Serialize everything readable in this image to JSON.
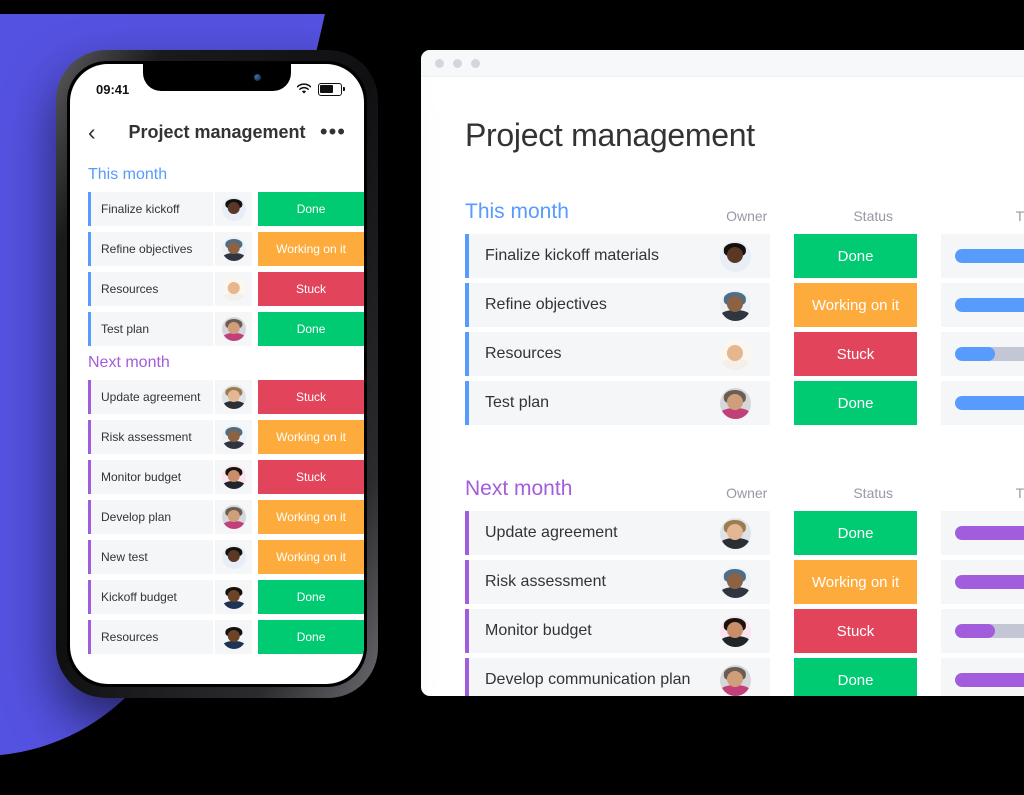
{
  "colors": {
    "blue": "#579bfc",
    "purple": "#a25ddc",
    "green": "#00ca72",
    "orange": "#fdab3d",
    "red": "#e2445c",
    "grey_track": "#c3c6d4",
    "bg_accent": "#5452e0"
  },
  "browser": {
    "window_dots": [
      "dot-1",
      "dot-2",
      "dot-3"
    ],
    "page_title": "Project management",
    "column_headers": {
      "owner": "Owner",
      "status": "Status",
      "timeline": "Timeline"
    },
    "sections": [
      {
        "title": "This month",
        "accent": "#579bfc",
        "rows": [
          {
            "name": "Finalize kickoff materials",
            "owner": "avatar-woman-glasses",
            "status": "Done",
            "status_color": "#00ca72",
            "timeline_pct": 72
          },
          {
            "name": "Refine objectives",
            "owner": "avatar-man-beard-cap",
            "status": "Working on it",
            "status_color": "#fdab3d",
            "timeline_pct": 72
          },
          {
            "name": "Resources",
            "owner": "avatar-woman-blonde",
            "status": "Stuck",
            "status_color": "#e2445c",
            "timeline_pct": 24
          },
          {
            "name": "Test plan",
            "owner": "avatar-man-beard",
            "status": "Done",
            "status_color": "#00ca72",
            "timeline_pct": 100
          }
        ]
      },
      {
        "title": "Next month",
        "accent": "#a25ddc",
        "rows": [
          {
            "name": "Update agreement",
            "owner": "avatar-man-blond",
            "status": "Done",
            "status_color": "#00ca72",
            "timeline_pct": 100
          },
          {
            "name": "Risk assessment",
            "owner": "avatar-man-beard-cap",
            "status": "Working on it",
            "status_color": "#fdab3d",
            "timeline_pct": 72
          },
          {
            "name": "Monitor budget",
            "owner": "avatar-woman-dark",
            "status": "Stuck",
            "status_color": "#e2445c",
            "timeline_pct": 24
          },
          {
            "name": "Develop communication plan",
            "owner": "avatar-man-beard",
            "status": "Done",
            "status_color": "#00ca72",
            "timeline_pct": 100
          }
        ]
      }
    ]
  },
  "phone": {
    "status_bar": {
      "time": "09:41",
      "wifi": "wifi-icon",
      "battery": "battery-icon"
    },
    "nav": {
      "back": "‹",
      "title": "Project management",
      "more": "•••"
    },
    "sections": [
      {
        "title": "This month",
        "accent": "#579bfc",
        "rows": [
          {
            "name": "Finalize kickoff",
            "owner": "avatar-woman-glasses",
            "status": "Done",
            "status_color": "#00ca72"
          },
          {
            "name": "Refine objectives",
            "owner": "avatar-man-beard-cap",
            "status": "Working on it",
            "status_color": "#fdab3d"
          },
          {
            "name": "Resources",
            "owner": "avatar-woman-blonde",
            "status": "Stuck",
            "status_color": "#e2445c"
          },
          {
            "name": "Test plan",
            "owner": "avatar-man-beard",
            "status": "Done",
            "status_color": "#00ca72"
          }
        ]
      },
      {
        "title": "Next month",
        "accent": "#a25ddc",
        "rows": [
          {
            "name": "Update agreement",
            "owner": "avatar-man-blond",
            "status": "Stuck",
            "status_color": "#e2445c"
          },
          {
            "name": "Risk assessment",
            "owner": "avatar-man-beard-cap",
            "status": "Working on it",
            "status_color": "#fdab3d"
          },
          {
            "name": "Monitor budget",
            "owner": "avatar-woman-dark",
            "status": "Stuck",
            "status_color": "#e2445c"
          },
          {
            "name": "Develop plan",
            "owner": "avatar-man-beard",
            "status": "Working on it",
            "status_color": "#fdab3d"
          },
          {
            "name": "New test",
            "owner": "avatar-woman-glasses",
            "status": "Working on it",
            "status_color": "#fdab3d"
          },
          {
            "name": "Kickoff budget",
            "owner": "avatar-man-dark",
            "status": "Done",
            "status_color": "#00ca72"
          },
          {
            "name": "Resources",
            "owner": "avatar-man-dark",
            "status": "Done",
            "status_color": "#00ca72"
          }
        ]
      }
    ]
  },
  "avatars": {
    "avatar-woman-glasses": {
      "bg": "#e8eef8",
      "skin": "#5a3825",
      "hair": "#15100c",
      "body": "#e9eef6"
    },
    "avatar-man-beard-cap": {
      "bg": "#eef1f5",
      "skin": "#8b6243",
      "hair": "#4e6d86",
      "body": "#2f3640"
    },
    "avatar-woman-blonde": {
      "bg": "#fbf6ef",
      "skin": "#e6b68f",
      "hair": "#d9a martin",
      "body": "#f4efe8"
    },
    "avatar-man-beard": {
      "bg": "#d5d7da",
      "skin": "#cf9f7c",
      "hair": "#6d5c52",
      "body": "#c1407a"
    },
    "avatar-man-blond": {
      "bg": "#dfe2e6",
      "skin": "#e3b793",
      "hair": "#9d7b51",
      "body": "#2b2f36"
    },
    "avatar-woman-dark": {
      "bg": "#fbe3ef",
      "skin": "#c98d6a",
      "hair": "#17130f",
      "body": "#20242b"
    },
    "avatar-man-dark": {
      "bg": "#f3f5f8",
      "skin": "#6b4427",
      "hair": "#14100d",
      "body": "#1f3352"
    }
  }
}
